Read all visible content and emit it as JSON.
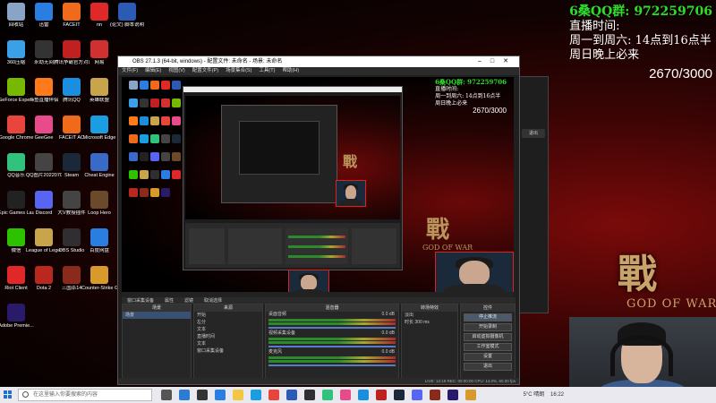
{
  "overlay": {
    "qq_group": "6桑QQ群:   972259706",
    "schedule_title": "直播时间:",
    "schedule_weekday": "周一到周六:   14点到16点半",
    "schedule_sunday": "周日晚上必来",
    "counter": "2670/3000"
  },
  "wallpaper": {
    "logo_char": "戰",
    "logo_text": "GOD OF WAR"
  },
  "desktop_icons": [
    {
      "label": "回收站",
      "color": "#8aa4c8"
    },
    {
      "label": "迅雷",
      "color": "#2a7de1"
    },
    {
      "label": "FACEIT",
      "color": "#f06a1c"
    },
    {
      "label": "nn",
      "color": "#e02828"
    },
    {
      "label": "(论文) 脚本说明",
      "color": "#2b5bb5"
    },
    {
      "label": "360压缩",
      "color": "#3aa0e8"
    },
    {
      "label": "永劫无间",
      "color": "#333333"
    },
    {
      "label": "腾讯争霸官方对战平台",
      "color": "#c02020"
    },
    {
      "label": "网易",
      "color": "#d03030"
    },
    {
      "label": "GeForce Experience",
      "color": "#76b900"
    },
    {
      "label": "斗鱼直播伴侣",
      "color": "#ff7a1a"
    },
    {
      "label": "腾讯QQ",
      "color": "#1a8fe0"
    },
    {
      "label": "英雄联盟",
      "color": "#c8a44a"
    },
    {
      "label": "Google Chrome",
      "color": "#e8453c"
    },
    {
      "label": "GeeGee",
      "color": "#e84a8a"
    },
    {
      "label": "FACEIT AC",
      "color": "#f06a1c"
    },
    {
      "label": "Microsoft Edge",
      "color": "#1b9de2"
    },
    {
      "label": "QQ音乐",
      "color": "#31c27c"
    },
    {
      "label": "QQ图片2022070...",
      "color": "#444444"
    },
    {
      "label": "Steam",
      "color": "#1b2838"
    },
    {
      "label": "Cheat Engine",
      "color": "#3a6ac8"
    },
    {
      "label": "Epic Games Launcher",
      "color": "#222222"
    },
    {
      "label": "Discord",
      "color": "#5865f2"
    },
    {
      "label": "大V教授插件",
      "color": "#444444"
    },
    {
      "label": "Loop Hero",
      "color": "#6a4a2a"
    },
    {
      "label": "微信",
      "color": "#2dc100"
    },
    {
      "label": "League of Legends",
      "color": "#c8a44a"
    },
    {
      "label": "OBS Studio",
      "color": "#302e31"
    },
    {
      "label": "百度网盘",
      "color": "#2a7de1"
    },
    {
      "label": "Riot Client",
      "color": "#e02828"
    },
    {
      "label": "Dota 2",
      "color": "#b8281e"
    },
    {
      "label": "三国杀14",
      "color": "#8a2a1a"
    },
    {
      "label": "Counter-Strike Global Off...",
      "color": "#d89a2a"
    },
    {
      "label": "Adobe Premie...",
      "color": "#2a1a6a"
    }
  ],
  "obs": {
    "title": "OBS 27.1.3 (64-bit, windows) - 配置文件: 未命名 - 场景: 未命名",
    "menu": [
      "文件(F)",
      "编辑(E)",
      "视图(V)",
      "配置文件(P)",
      "场景集合(S)",
      "工具(T)",
      "帮助(H)"
    ],
    "source_bar": [
      "窗口采集设备",
      "属性",
      "滤镜",
      "取消选择"
    ],
    "panels": {
      "scenes_header": "场景",
      "scenes": [
        "场景"
      ],
      "sources_header": "来源",
      "sources": [
        "开始",
        "左分",
        "文本",
        "直播时间",
        "文本",
        "窗口采集设备"
      ],
      "mixer_header": "混音器",
      "mixer": [
        {
          "name": "桌面音频",
          "db": "0.0 dB"
        },
        {
          "name": "视频采集设备",
          "db": "0.0 dB"
        },
        {
          "name": "麦克风",
          "db": "0.0 dB"
        }
      ],
      "transitions_header": "转场特效",
      "transition_type": "淡出",
      "duration_label": "时长",
      "duration_value": "300 ms",
      "controls_header": "控件",
      "controls": [
        "停止推流",
        "开始录制",
        "启动虚拟摄像机",
        "工作室模式",
        "设置",
        "退出"
      ]
    },
    "status": "LIVE: 12:19   REC: 00:00:00   CPU: 14.0%, 60.00 fps"
  },
  "taskbar": {
    "search_placeholder": "在这里输入你要搜索的内容",
    "weather": "5°C 晴朗",
    "time": "16:22"
  },
  "sidewin": {
    "button": "退出"
  }
}
